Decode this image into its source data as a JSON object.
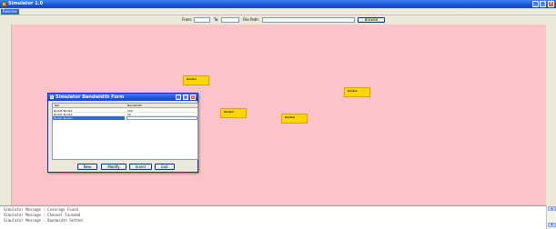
{
  "window": {
    "title": "Simulator 1.0"
  },
  "menubar": {
    "items": [
      "Resolve"
    ]
  },
  "toolbar": {
    "from_label": "From:",
    "to_label": "To:",
    "filepath_label": "File Path:",
    "browse_label": "Browse",
    "from_value": "",
    "to_value": "",
    "filepath_value": ""
  },
  "canvas": {
    "background": "#fcc3c8",
    "nodes": [
      {
        "label": "Node3"
      },
      {
        "label": "Node1"
      },
      {
        "label": "Node4"
      },
      {
        "label": "Node2"
      }
    ]
  },
  "dialog": {
    "title": "Simulator Bandwidth Form",
    "columns": [
      "Pair",
      "Bandwidth"
    ],
    "rows": [
      {
        "pair": "Node1-Node2",
        "bandwidth": "100"
      },
      {
        "pair": "Node1-Node3",
        "bandwidth": "50"
      },
      {
        "pair": "Node1-Node4",
        "bandwidth": ""
      }
    ],
    "buttons": {
      "new": "New",
      "modify": "Modify",
      "insert": "Insert",
      "exit": "Exit"
    }
  },
  "messages": [
    "Simulator Message : Coverage Found",
    "Simulator Message : Channel Founded",
    "Simulator Message : Bandwidth Setted"
  ]
}
